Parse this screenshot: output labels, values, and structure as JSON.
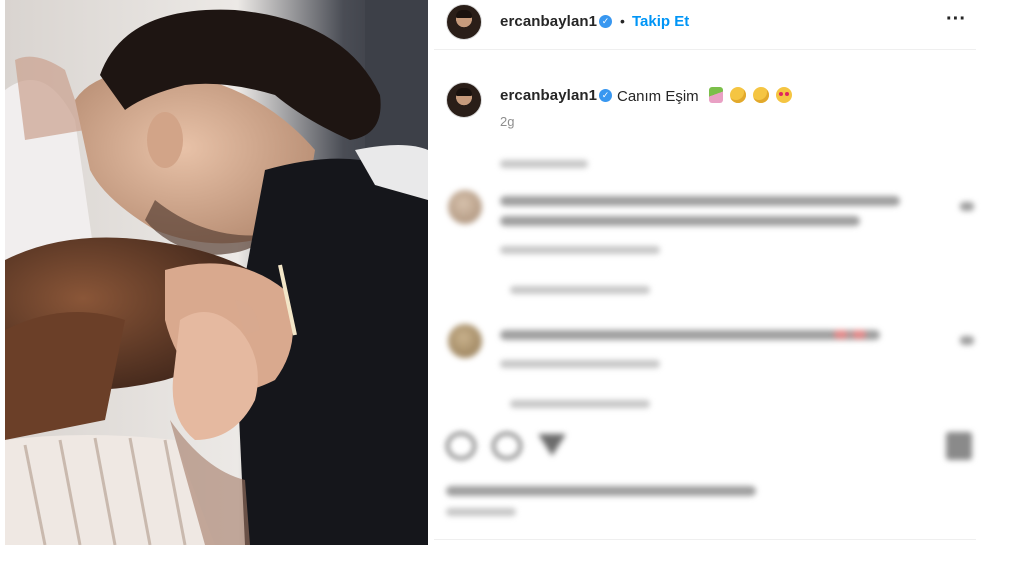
{
  "post": {
    "username": "ercanbaylan1",
    "verified_mark": "✓",
    "separator": "•",
    "follow_label": "Takip Et",
    "more_icon": "more-options-icon",
    "caption": {
      "username": "ercanbaylan1",
      "text": "Canım Eşim",
      "emojis": [
        "flower-bouquet-icon",
        "crying-face-icon",
        "crying-face-icon",
        "heart-eyes-face-icon"
      ],
      "time": "2g"
    }
  },
  "colors": {
    "follow": "#0095f6",
    "verified": "#3897f0",
    "muted": "#8e8e8e"
  },
  "icons": {
    "like": "heart-icon",
    "comment": "comment-icon",
    "share": "share-icon",
    "save": "bookmark-icon"
  }
}
